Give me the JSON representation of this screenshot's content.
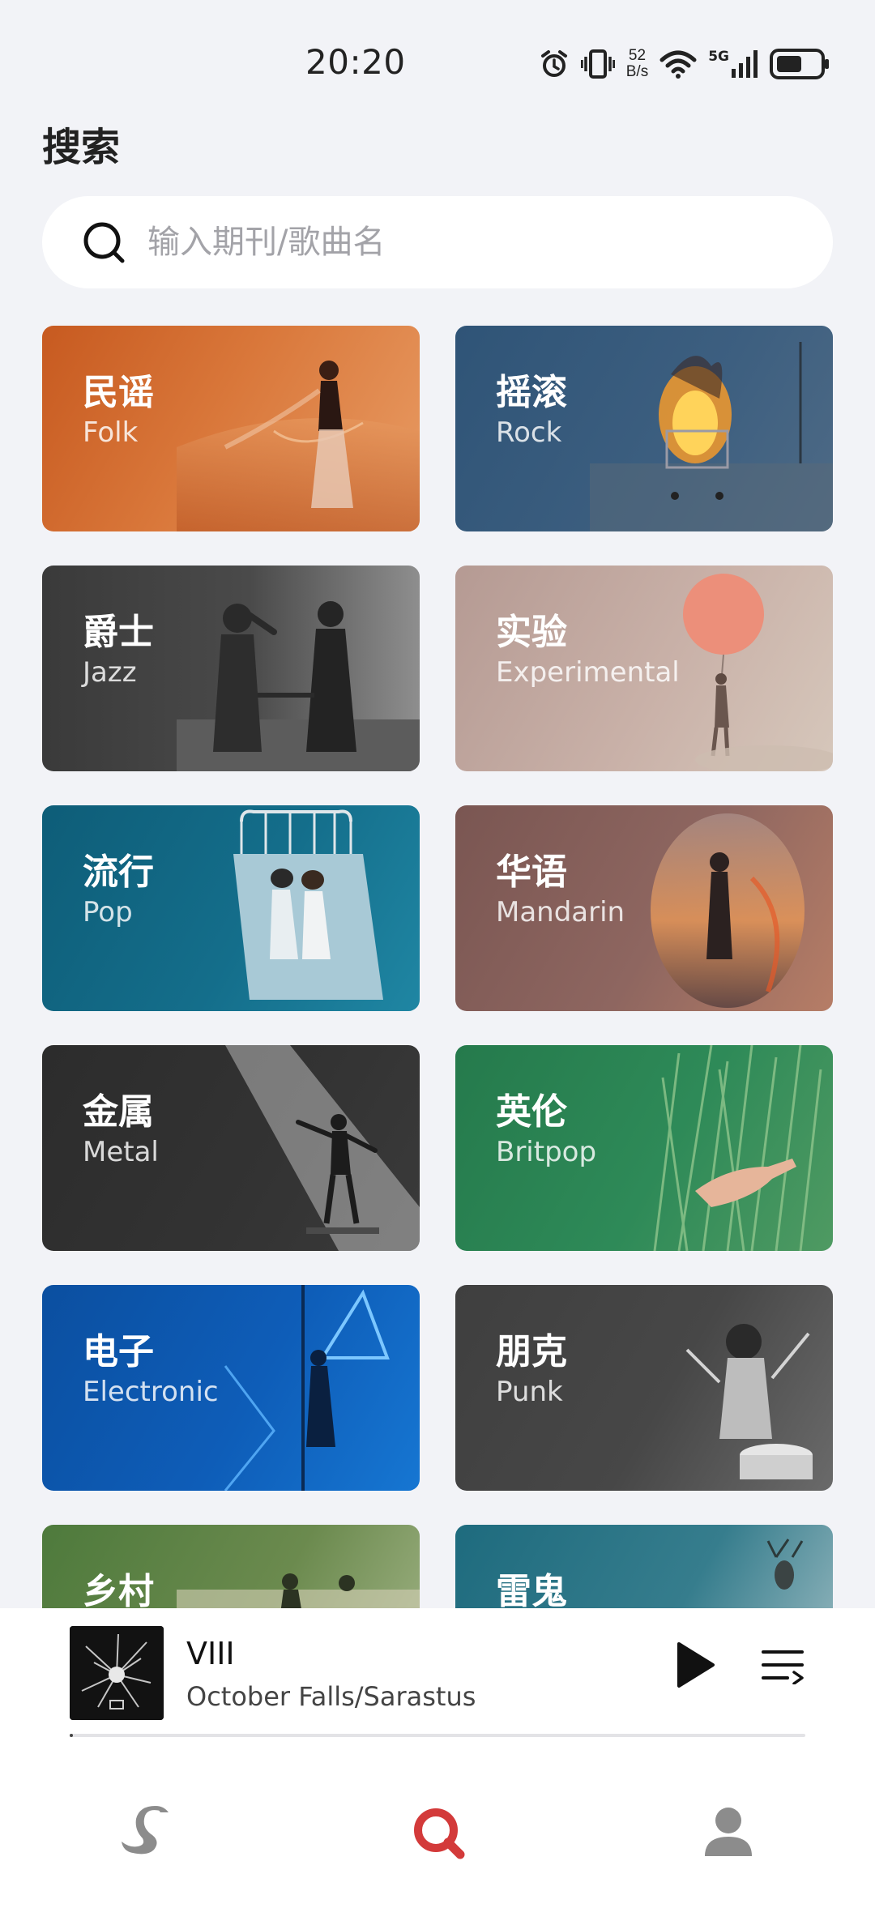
{
  "status_bar": {
    "time": "20:20",
    "net_speed_value": "52",
    "net_speed_unit": "B/s",
    "network": "5G",
    "icons": [
      "alarm-icon",
      "vibrate-icon",
      "wifi-icon",
      "signal-icon",
      "battery-icon"
    ]
  },
  "page": {
    "title": "搜索"
  },
  "search": {
    "placeholder": "输入期刊/歌曲名",
    "value": ""
  },
  "genres": [
    {
      "cn": "民谣",
      "en": "Folk"
    },
    {
      "cn": "摇滚",
      "en": "Rock"
    },
    {
      "cn": "爵士",
      "en": "Jazz"
    },
    {
      "cn": "实验",
      "en": "Experimental"
    },
    {
      "cn": "流行",
      "en": "Pop"
    },
    {
      "cn": "华语",
      "en": "Mandarin"
    },
    {
      "cn": "金属",
      "en": "Metal"
    },
    {
      "cn": "英伦",
      "en": "Britpop"
    },
    {
      "cn": "电子",
      "en": "Electronic"
    },
    {
      "cn": "朋克",
      "en": "Punk"
    },
    {
      "cn": "乡村",
      "en": ""
    },
    {
      "cn": "雷鬼",
      "en": ""
    }
  ],
  "player": {
    "title": "VIII",
    "artist": "October Falls/Sarastus",
    "progress": 0.004
  },
  "nav": {
    "items": [
      "swan-icon",
      "search-icon",
      "profile-icon"
    ],
    "active": "search-icon",
    "active_color": "#d33a3a"
  }
}
